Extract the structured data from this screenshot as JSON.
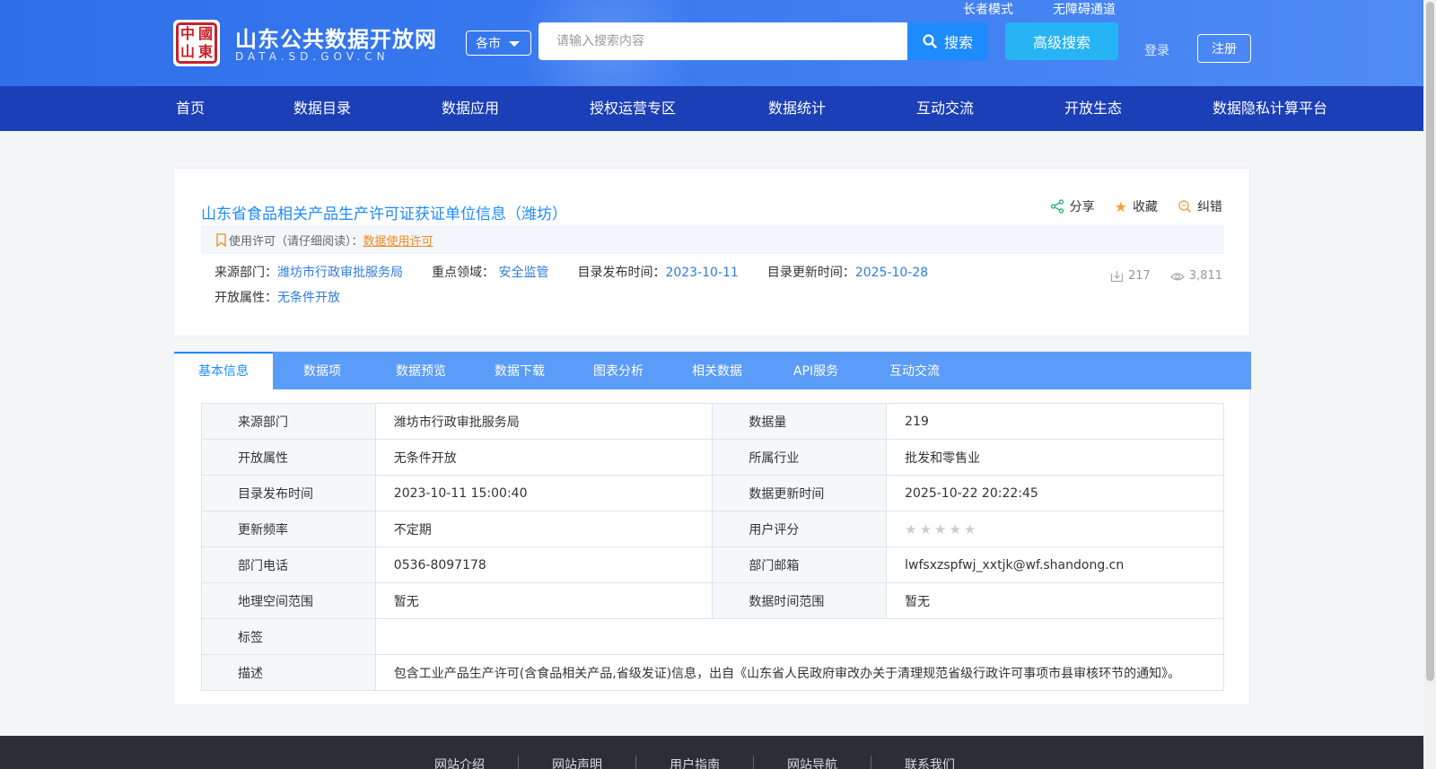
{
  "header": {
    "logo_chars": [
      "中",
      "國",
      "山",
      "東"
    ],
    "site_title": "山东公共数据开放网",
    "site_domain": "DATA.SD.GOV.CN",
    "city_select": "各市",
    "search_placeholder": "请输入搜索内容",
    "search_button": "搜索",
    "advanced_search": "高级搜索",
    "elder_mode": "长者模式",
    "accessibility": "无障碍通道",
    "login": "登录",
    "register": "注册"
  },
  "nav": {
    "items": [
      "首页",
      "数据目录",
      "数据应用",
      "授权运营专区",
      "数据统计",
      "互动交流",
      "开放生态",
      "数据隐私计算平台"
    ]
  },
  "dataset": {
    "title": "山东省食品相关产品生产许可证获证单位信息（潍坊）",
    "actions": {
      "share": "分享",
      "favorite": "收藏",
      "report": "纠错"
    },
    "license_label": "使用许可（请仔细阅读）：",
    "license_link": "数据使用许可",
    "source_label": "来源部门：",
    "source_value": "潍坊市行政审批服务局",
    "domain_label": "重点领域：",
    "domain_value": "安全监管",
    "publish_label": "目录发布时间：",
    "publish_value": "2023-10-11",
    "update_label": "目录更新时间：",
    "update_value": "2025-10-28",
    "open_label": "开放属性：",
    "open_value": "无条件开放",
    "downloads": "217",
    "views": "3,811"
  },
  "tabs": {
    "items": [
      "基本信息",
      "数据项",
      "数据预览",
      "数据下载",
      "图表分析",
      "相关数据",
      "API服务",
      "互动交流"
    ],
    "active": 0
  },
  "info_table": {
    "rows": [
      {
        "l1": "来源部门",
        "v1": "潍坊市行政审批服务局",
        "l2": "数据量",
        "v2": "219"
      },
      {
        "l1": "开放属性",
        "v1": "无条件开放",
        "l2": "所属行业",
        "v2": "批发和零售业"
      },
      {
        "l1": "目录发布时间",
        "v1": "2023-10-11 15:00:40",
        "l2": "数据更新时间",
        "v2": "2025-10-22 20:22:45"
      },
      {
        "l1": "更新频率",
        "v1": "不定期",
        "l2": "用户评分",
        "v2": ""
      },
      {
        "l1": "部门电话",
        "v1": "0536-8097178",
        "l2": "部门邮箱",
        "v2": "lwfsxzspfwj_xxtjk@wf.shandong.cn"
      },
      {
        "l1": "地理空间范围",
        "v1": "暂无",
        "l2": "数据时间范围",
        "v2": "暂无"
      }
    ],
    "rating": 0,
    "rating_max": 5,
    "tags_label": "标签",
    "tags_value": "",
    "desc_label": "描述",
    "desc_value": "包含工业产品生产许可(含食品相关产品,省级发证)信息，出自《山东省人民政府审改办关于清理规范省级行政许可事项市县审核环节的通知》。"
  },
  "footer": {
    "links": [
      "网站介绍",
      "网站声明",
      "用户指南",
      "网站导航",
      "联系我们"
    ]
  },
  "colors": {
    "header_blue": "#2f6fe8",
    "nav_blue": "#1b3fb6",
    "tab_blue": "#5b9cf9",
    "link_blue": "#1e8bff",
    "license_orange": "#f08a1c",
    "star_orange": "#f7a234"
  }
}
